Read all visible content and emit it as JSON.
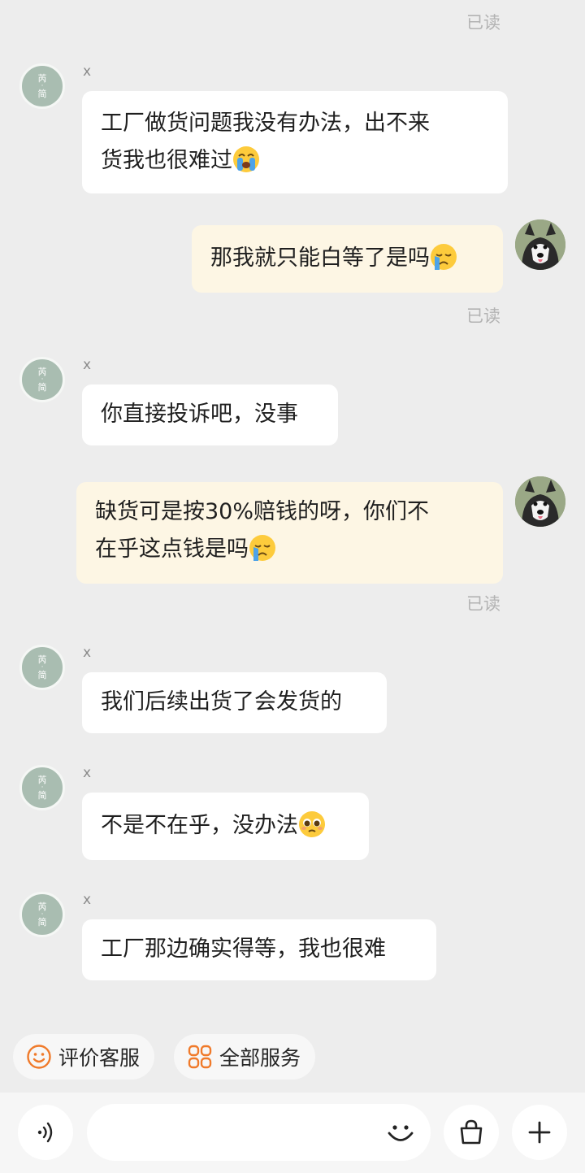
{
  "read_label": "已读",
  "shop_avatar_text": {
    "top": "芮",
    "dot": "·",
    "bottom": "简"
  },
  "messages": [
    {
      "from": "shop",
      "sender": "x",
      "lines": [
        "工厂做货问题我没有办法，出不来",
        "货我也很难过"
      ],
      "emoji": "loudly-crying-face"
    },
    {
      "from": "user",
      "lines": [
        "那我就只能白等了是吗"
      ],
      "emoji": "crying-face",
      "status": "已读"
    },
    {
      "from": "shop",
      "sender": "x",
      "lines": [
        "你直接投诉吧，没事"
      ]
    },
    {
      "from": "user",
      "lines": [
        "缺货可是按30%赔钱的呀，你们不",
        "在乎这点钱是吗"
      ],
      "emoji": "crying-face",
      "status": "已读"
    },
    {
      "from": "shop",
      "sender": "x",
      "lines": [
        "我们后续出货了会发货的"
      ]
    },
    {
      "from": "shop",
      "sender": "x",
      "lines": [
        "不是不在乎，没办法"
      ],
      "emoji": "pleading-face"
    },
    {
      "from": "shop",
      "sender": "x",
      "lines": [
        "工厂那边确实得等，我也很难"
      ]
    }
  ],
  "quick_actions": [
    {
      "label": "评价客服",
      "icon": "smiley-outline-icon",
      "color": "#f07a2a"
    },
    {
      "label": "全部服务",
      "icon": "grid-services-icon",
      "color": "#f07a2a"
    }
  ],
  "input": {
    "placeholder": "",
    "value": ""
  },
  "toolbar": {
    "voice": "voice-icon",
    "emoji": "emoji-icon",
    "bag": "shopping-bag-icon",
    "more": "plus-icon"
  }
}
